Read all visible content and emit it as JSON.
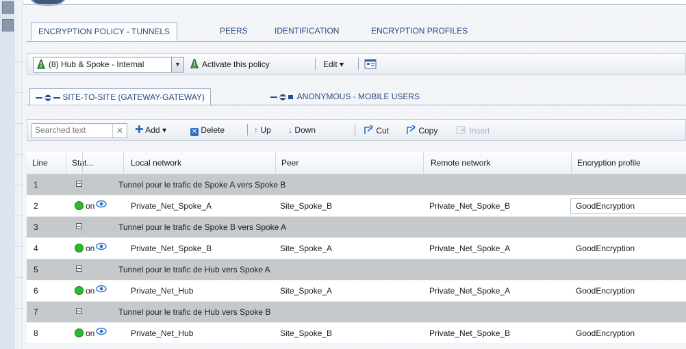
{
  "main_tabs": [
    {
      "label": "ENCRYPTION POLICY - TUNNELS",
      "active": true
    },
    {
      "label": "PEERS",
      "active": false
    },
    {
      "label": "IDENTIFICATION",
      "active": false
    },
    {
      "label": "ENCRYPTION PROFILES",
      "active": false
    }
  ],
  "policy_toolbar": {
    "selected_policy": "(8) Hub & Spoke - Internal",
    "activate_label": "Activate this policy",
    "edit_label": "Edit"
  },
  "sub_tabs": [
    {
      "label": "SITE-TO-SITE (GATEWAY-GATEWAY)",
      "active": true
    },
    {
      "label": "ANONYMOUS - MOBILE USERS",
      "active": false
    }
  ],
  "list_toolbar": {
    "search_placeholder": "Searched text",
    "add_label": "Add",
    "delete_label": "Delete",
    "up_label": "Up",
    "down_label": "Down",
    "cut_label": "Cut",
    "copy_label": "Copy",
    "insert_label": "Insert"
  },
  "table": {
    "columns": [
      "Line",
      "Stat...",
      "Local network",
      "Peer",
      "Remote network",
      "Encryption profile"
    ],
    "rows": [
      {
        "type": "separator",
        "line": "1",
        "text": "Tunnel pour le trafic de Spoke A vers Spoke B"
      },
      {
        "type": "data",
        "line": "2",
        "status": "on",
        "local": "Private_Net_Spoke_A",
        "peer": "Site_Spoke_B",
        "remote": "Private_Net_Spoke_B",
        "profile": "GoodEncryption",
        "editing": true
      },
      {
        "type": "separator",
        "line": "3",
        "text": "Tunnel pour le trafic de Spoke B vers Spoke A"
      },
      {
        "type": "data",
        "line": "4",
        "status": "on",
        "local": "Private_Net_Spoke_B",
        "peer": "Site_Spoke_A",
        "remote": "Private_Net_Spoke_A",
        "profile": "GoodEncryption",
        "editing": false
      },
      {
        "type": "separator",
        "line": "5",
        "text": "Tunnel pour le trafic de Hub vers Spoke A"
      },
      {
        "type": "data",
        "line": "6",
        "status": "on",
        "local": "Private_Net_Hub",
        "peer": "Site_Spoke_A",
        "remote": "Private_Net_Spoke_A",
        "profile": "GoodEncryption",
        "editing": false
      },
      {
        "type": "separator",
        "line": "7",
        "text": "Tunnel pour le trafic de Hub vers Spoke B"
      },
      {
        "type": "data",
        "line": "8",
        "status": "on",
        "local": "Private_Net_Hub",
        "peer": "Site_Spoke_B",
        "remote": "Private_Net_Spoke_B",
        "profile": "GoodEncryption",
        "editing": false
      }
    ]
  },
  "colors": {
    "tab_text": "#2a4d84",
    "separator_row": "#c6c9cc",
    "status_on": "#2bbb2b",
    "add_icon": "#2a6fc9",
    "delete_icon": "#2a6fc9"
  }
}
